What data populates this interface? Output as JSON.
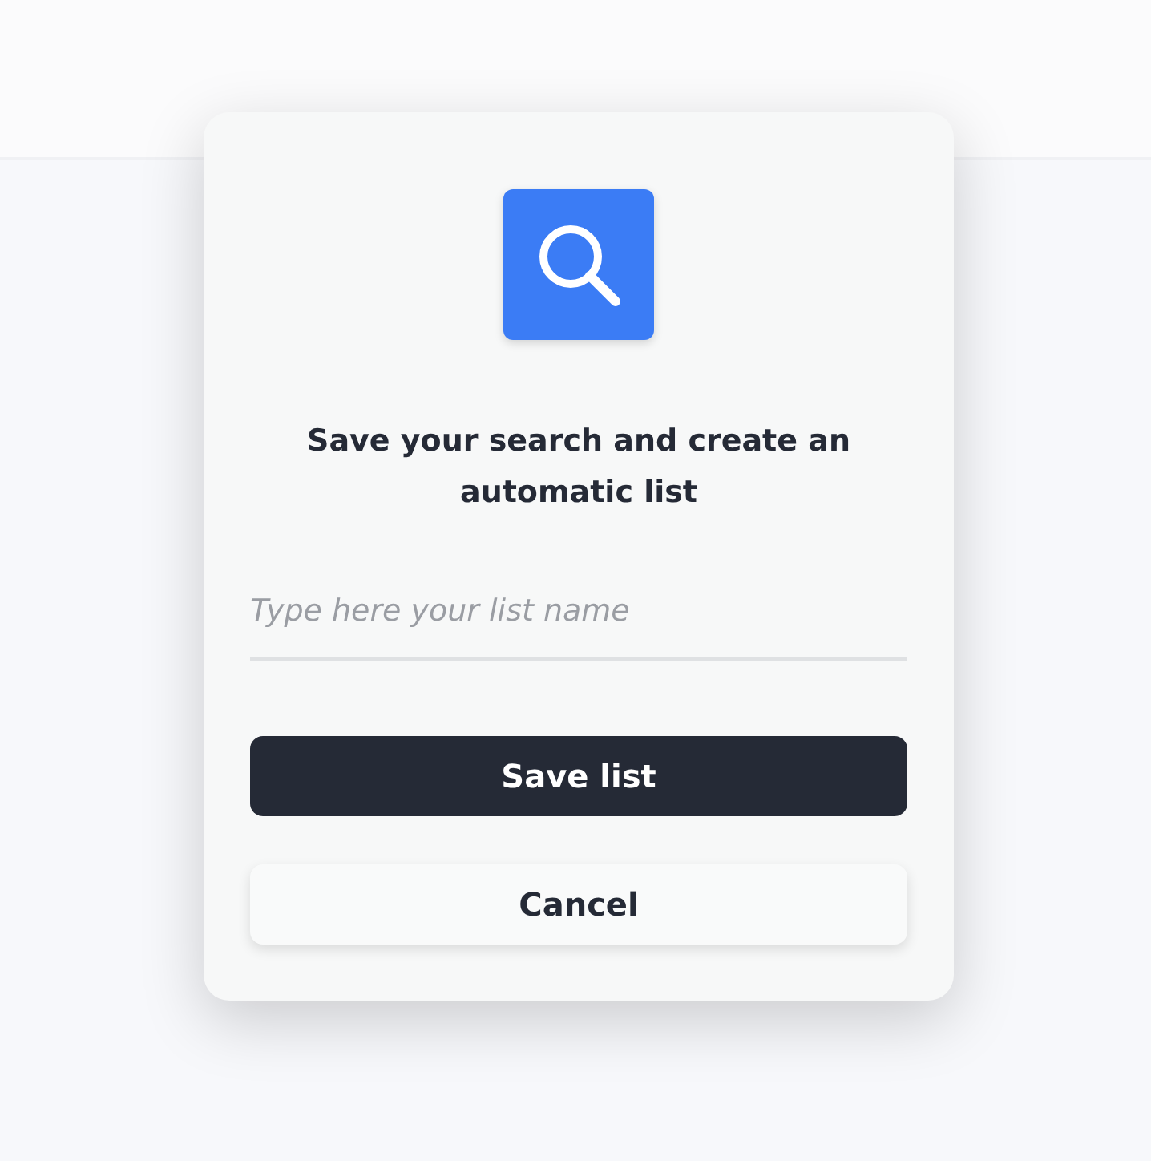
{
  "dialog": {
    "title": "Save your search and create an automatic list",
    "name_field": {
      "placeholder": "Type here your list name"
    },
    "buttons": [
      {
        "label": "Save list",
        "kind": "primary"
      },
      {
        "label": "Cancel",
        "kind": "secondary"
      }
    ]
  }
}
